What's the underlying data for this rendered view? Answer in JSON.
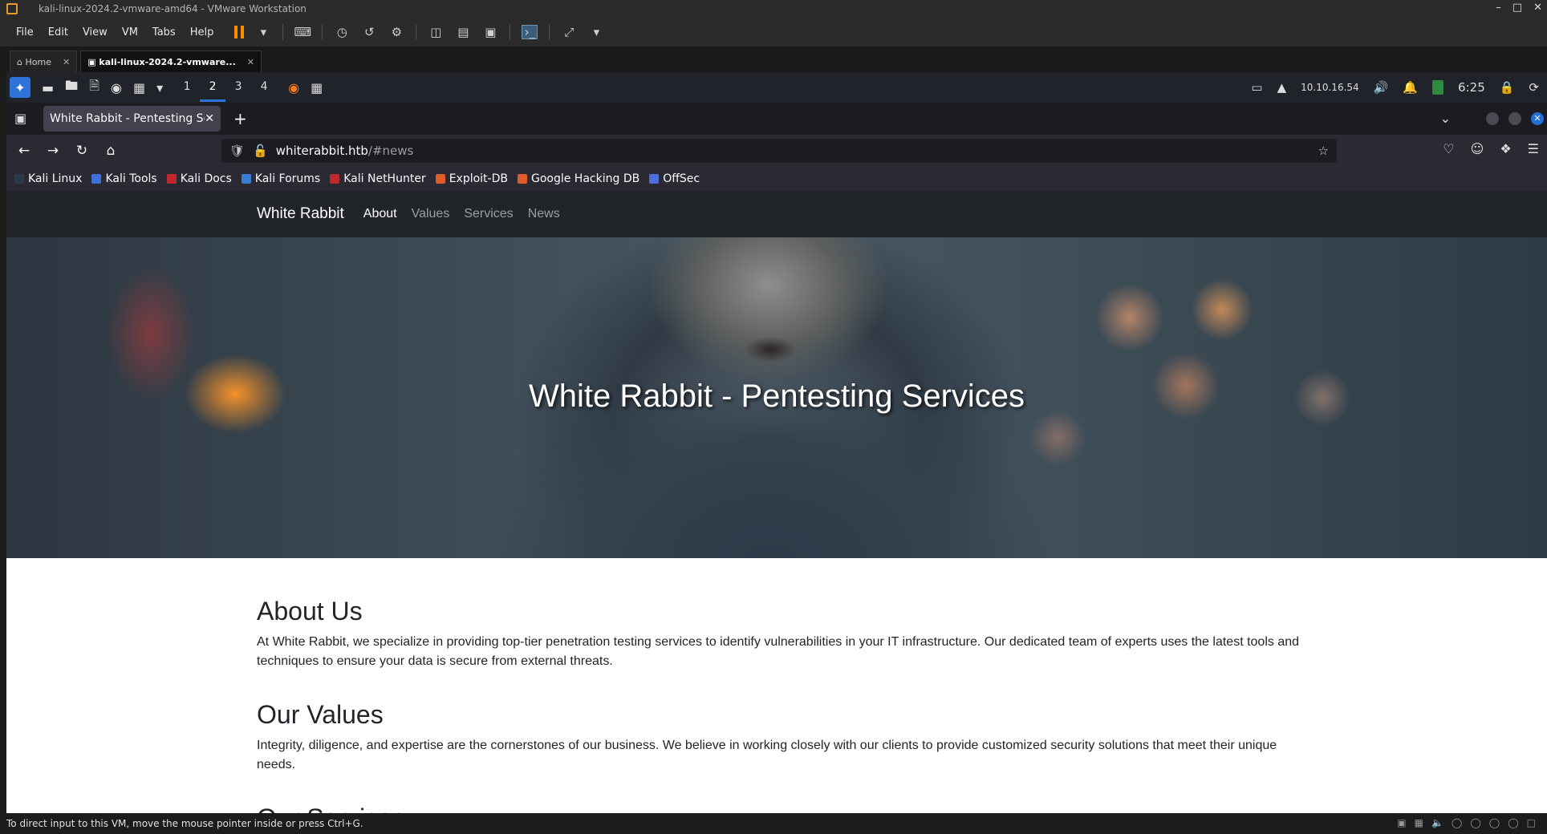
{
  "vmware": {
    "title": "kali-linux-2024.2-vmware-amd64 - VMware Workstation",
    "menu": [
      "File",
      "Edit",
      "View",
      "VM",
      "Tabs",
      "Help"
    ],
    "tabs": [
      {
        "label": "Home"
      },
      {
        "label": "kali-linux-2024.2-vmware..."
      }
    ],
    "status_text": "To direct input to this VM, move the mouse pointer inside or press Ctrl+G."
  },
  "kali_panel": {
    "workspaces": [
      "1",
      "2",
      "3",
      "4"
    ],
    "current_workspace": "2",
    "ip": "10.10.16.54",
    "time": "6:25"
  },
  "firefox": {
    "tab_title": "White Rabbit - Pentesting Se",
    "url_host": "whiterabbit.htb",
    "url_path": "/#news",
    "bookmarks": [
      {
        "label": "Kali Linux",
        "color": "#2d3a4a"
      },
      {
        "label": "Kali Tools",
        "color": "#3d6fd8"
      },
      {
        "label": "Kali Docs",
        "color": "#c0282d"
      },
      {
        "label": "Kali Forums",
        "color": "#3a7bd5"
      },
      {
        "label": "Kali NetHunter",
        "color": "#c0282d"
      },
      {
        "label": "Exploit-DB",
        "color": "#e05a2a"
      },
      {
        "label": "Google Hacking DB",
        "color": "#e05a2a"
      },
      {
        "label": "OffSec",
        "color": "#4a6fd8"
      }
    ]
  },
  "site": {
    "brand": "White Rabbit",
    "nav": [
      "About",
      "Values",
      "Services",
      "News"
    ],
    "hero_title": "White Rabbit - Pentesting Services",
    "sections": [
      {
        "heading": "About Us",
        "text": "At White Rabbit, we specialize in providing top-tier penetration testing services to identify vulnerabilities in your IT infrastructure. Our dedicated team of experts uses the latest tools and techniques to ensure your data is secure from external threats."
      },
      {
        "heading": "Our Values",
        "text": "Integrity, diligence, and expertise are the cornerstones of our business. We believe in working closely with our clients to provide customized security solutions that meet their unique needs."
      },
      {
        "heading": "Our Services",
        "text": ""
      }
    ]
  }
}
